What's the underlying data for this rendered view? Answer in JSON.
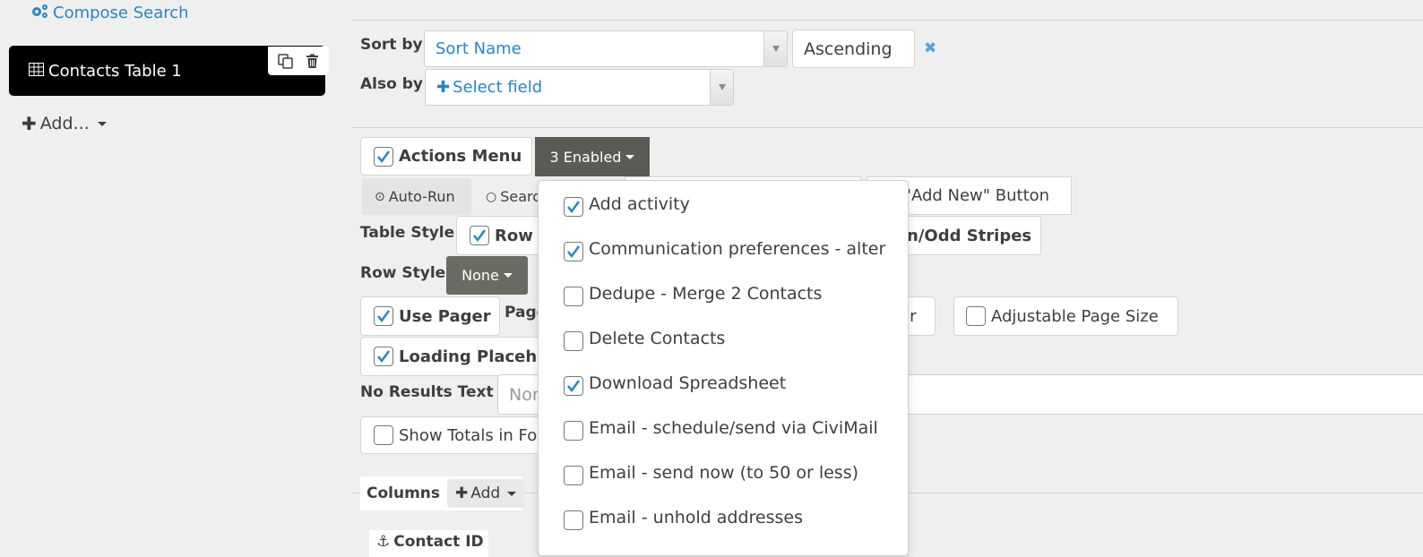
{
  "sidebar": {
    "compose_search": {
      "label": "Compose Search",
      "icon": "gears-icon"
    },
    "display_item": {
      "label": "Contacts Table 1",
      "icon": "table-icon",
      "actions": [
        "clone-icon",
        "trash-icon"
      ]
    },
    "add_button": {
      "label": "Add..."
    }
  },
  "sort": {
    "sort_by_label": "Sort by",
    "sort_field": "Sort Name",
    "direction": "Ascending",
    "remove_icon": "close-icon",
    "also_by_label": "Also by",
    "also_by_placeholder": "Select field"
  },
  "settings": {
    "actions_menu": {
      "label": "Actions Menu",
      "checked": true
    },
    "actions_enabled_button": "3 Enabled",
    "auto_run": "Auto-Run",
    "search_button_partial": "Searc",
    "add_new_button": {
      "label": "\"Add New\" Button",
      "visible_partial": "'Add New\" Button"
    },
    "table_style_label": "Table Style",
    "row_hover": {
      "label_partial": "Row",
      "checked": true
    },
    "stripes": {
      "label_partial": "n/Odd Stripes"
    },
    "row_style_label": "Row Style",
    "row_style_value": "None",
    "use_pager": {
      "label": "Use Pager",
      "checked": true
    },
    "page_label_partial": "Page",
    "pager_partial": "er",
    "adjustable_page_size": {
      "label": "Adjustable Page Size",
      "checked": false
    },
    "loading_placeholder": {
      "label_partial": "Loading Placeho",
      "checked": true
    },
    "no_results_label": "No Results Text",
    "no_results_placeholder_partial": "Nor",
    "show_totals": {
      "label_partial": "Show Totals in Fo",
      "checked": false
    }
  },
  "columns": {
    "label": "Columns",
    "add_label": "Add",
    "first_column_partial": "Contact ID"
  },
  "actions_dropdown": {
    "items": [
      {
        "label": "Add activity",
        "checked": true
      },
      {
        "label": "Communication preferences - alter",
        "checked": true
      },
      {
        "label": "Dedupe - Merge 2 Contacts",
        "checked": false
      },
      {
        "label": "Delete Contacts",
        "checked": false
      },
      {
        "label": "Download Spreadsheet",
        "checked": true
      },
      {
        "label": "Email - schedule/send via CiviMail",
        "checked": false
      },
      {
        "label": "Email - send now (to 50 or less)",
        "checked": false
      },
      {
        "label": "Email - unhold addresses",
        "checked": false
      }
    ]
  },
  "colors": {
    "accent": "#2786c2",
    "dark_button": "#5b5b55",
    "selected_item": "#000000",
    "background": "#efefef"
  }
}
